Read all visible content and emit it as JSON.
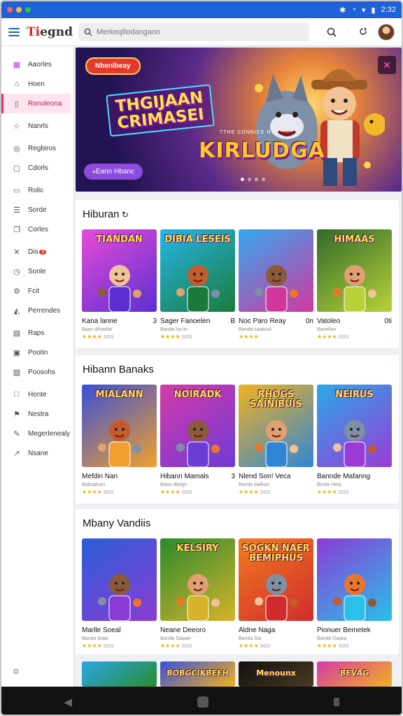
{
  "window": {
    "status_icons": [
      "✱",
      "◔",
      "▾",
      "▮"
    ],
    "time": "2:32"
  },
  "topbar": {
    "logo_prefix": "Ti",
    "logo_suffix": "egnd",
    "search_placeholder": "Merkeqtlodangann"
  },
  "sidebar": {
    "items": [
      {
        "label": "Aaorles",
        "icon": "grid-icon"
      },
      {
        "label": "Hoen",
        "icon": "home-icon"
      },
      {
        "label": "Ronoleona",
        "icon": "bookmark-icon",
        "active": true
      },
      {
        "label": "Nanrls",
        "icon": "star-icon"
      },
      {
        "label": "Regbiros",
        "icon": "circle-icon"
      },
      {
        "label": "Cdorls",
        "icon": "square-icon"
      },
      {
        "label": "Rolic",
        "icon": "doc-icon"
      },
      {
        "label": "Sorde",
        "icon": "list-icon"
      },
      {
        "label": "Corles",
        "icon": "copy-icon"
      },
      {
        "label": "Dis",
        "icon": "cross-icon",
        "badge": "3"
      },
      {
        "label": "Sonle",
        "icon": "clock-icon"
      },
      {
        "label": "Fcit",
        "icon": "gear-icon"
      },
      {
        "label": "Perrendes",
        "icon": "chart-icon"
      },
      {
        "label": "Raps",
        "icon": "page-icon"
      },
      {
        "label": "Pootin",
        "icon": "image-icon"
      },
      {
        "label": "Poosohs",
        "icon": "text-icon"
      },
      {
        "label": "Honte",
        "icon": "box-icon"
      },
      {
        "label": "Nestra",
        "icon": "flag-icon"
      },
      {
        "label": "Megerlenealy",
        "icon": "wrench-icon"
      },
      {
        "label": "Nsane",
        "icon": "share-icon"
      }
    ]
  },
  "hero": {
    "tag": "Nbenlbeay",
    "title_line1": "THGIJAAN",
    "title_line2": "CRIMASEI",
    "mini_text": "TTHE CONNICE NV",
    "main_title": "KIRLUDGA",
    "cta": "Eann Hbanc"
  },
  "sections": [
    {
      "title": "Hiburan",
      "icon": "refresh-icon",
      "cards": [
        {
          "thumb_text": "TIANDAN",
          "name": "Kana lanne",
          "rank": "3",
          "sub": "Baan dihadlat",
          "rating": "★★★★",
          "count": "SGS"
        },
        {
          "thumb_text": "DIBIA LESEIS",
          "name": "Sager Fanoelen",
          "rank": "B",
          "sub": "Banda ha lin",
          "rating": "★★★★",
          "count": "SGS"
        },
        {
          "thumb_text": "",
          "name": "Noc Paro Reay",
          "rank": "0n",
          "sub": "Banda saabuol",
          "rating": "★★★★",
          "count": ""
        },
        {
          "thumb_text": "HIMAAS",
          "name": "Vatoleo",
          "rank": "0ti",
          "sub": "Banelian",
          "rating": "★★★★",
          "count": "SGS"
        }
      ]
    },
    {
      "title": "Hibann Banaks",
      "icon": "",
      "cards": [
        {
          "thumb_text": "MIALANN",
          "name": "Mefdin Nan",
          "rank": "",
          "sub": "Babsaluon",
          "rating": "★★★★",
          "count": "SGS"
        },
        {
          "thumb_text": "NOIRADK",
          "name": "Hibann Mamals",
          "rank": "3",
          "sub": "Baan dilalgn",
          "rating": "★★★★",
          "count": "SGS"
        },
        {
          "thumb_text": "RHOGS SAINIBUIS",
          "name": "Nlend Son! Veca",
          "rank": "",
          "sub": "Banda Iiailkan",
          "rating": "★★★★",
          "count": "SGS"
        },
        {
          "thumb_text": "NEIRUS",
          "name": "Bannde Mafanng",
          "rank": "",
          "sub": "Binda Heta",
          "rating": "★★★★",
          "count": "SGS"
        }
      ]
    },
    {
      "title": "Mbany Vandiis",
      "icon": "",
      "cards": [
        {
          "thumb_text": "",
          "name": "Marlle Soeal",
          "rank": "",
          "sub": "Banda teaar",
          "rating": "★★★★",
          "count": "SGS"
        },
        {
          "thumb_text": "KELSIRY",
          "name": "Neane Deeoro",
          "rank": "",
          "sub": "Banda Saiaan",
          "rating": "★★★★",
          "count": "SGS"
        },
        {
          "thumb_text": "SOGKN NAER BEMIPHUS",
          "name": "Aldne Naga",
          "rank": "",
          "sub": "Banda Sia",
          "rating": "★★★★",
          "count": "SGS"
        },
        {
          "thumb_text": "",
          "name": "Pionuer Bemetek",
          "rank": "",
          "sub": "Banda Daaka",
          "rating": "★★★★",
          "count": "SGS"
        }
      ]
    }
  ],
  "peek": [
    {
      "thumb_text": ""
    },
    {
      "thumb_text": "BOBGCIKBEEH"
    },
    {
      "thumb_text": "Menounx"
    },
    {
      "thumb_text": "BEVAG"
    }
  ],
  "navbar": {
    "back": "◀"
  },
  "colors": {
    "accent": "#1f62d8",
    "active": "#e0346f",
    "star": "#f2b200"
  }
}
